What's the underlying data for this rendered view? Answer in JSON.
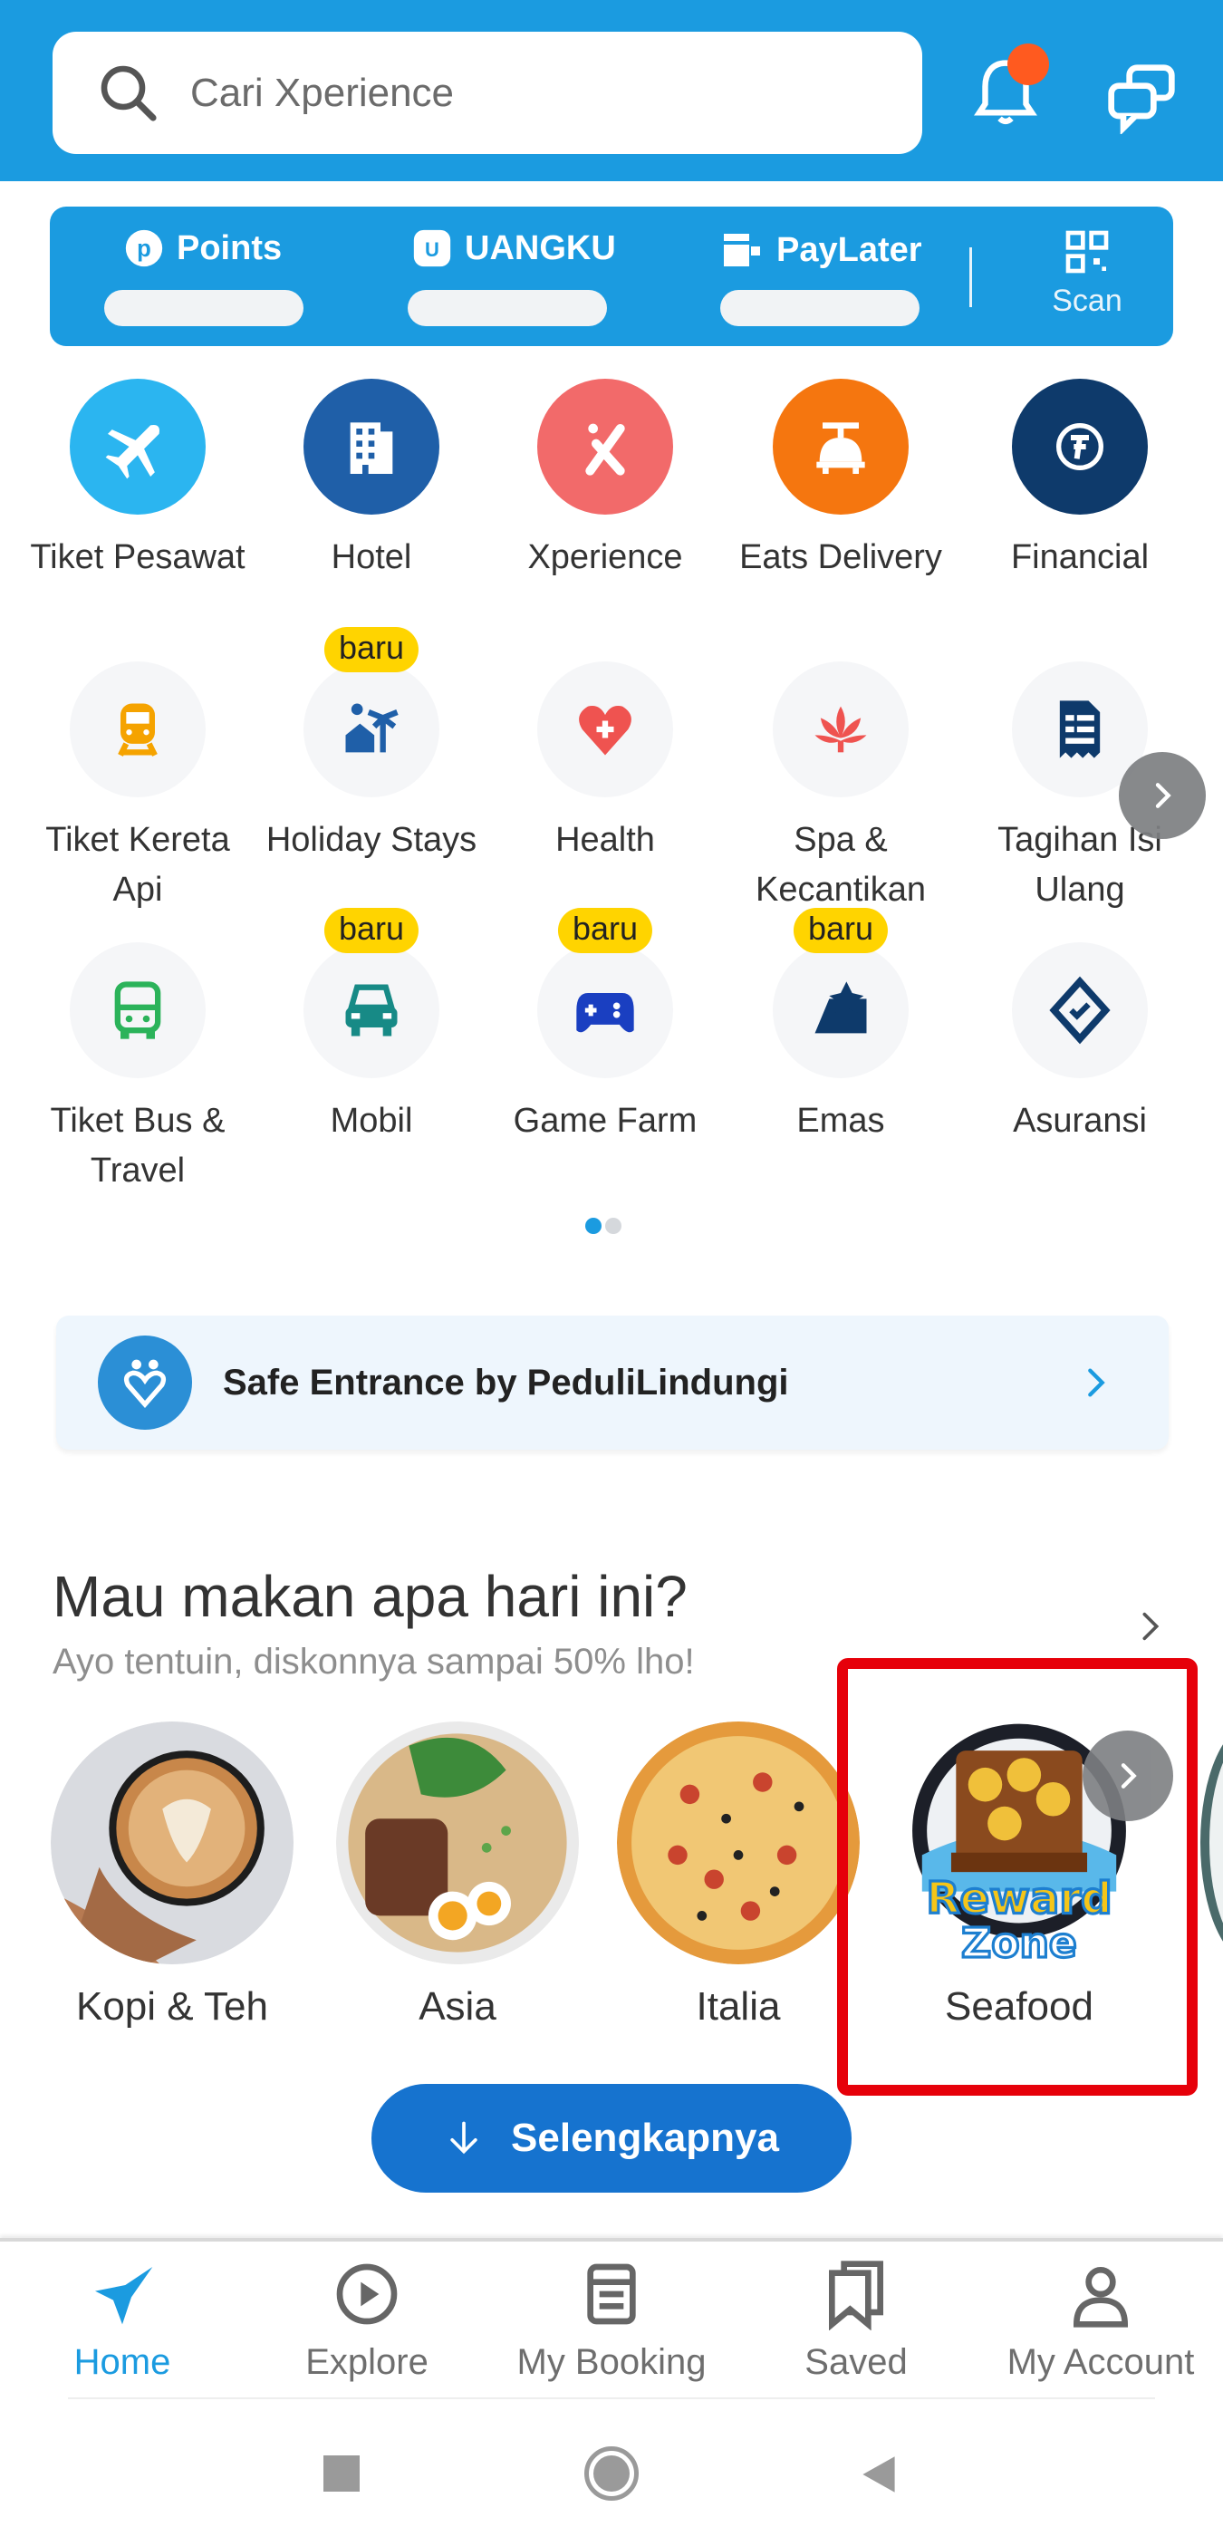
{
  "header": {
    "search_placeholder": "Cari Xperience",
    "notification_badge_color": "#ff5a1f",
    "brand_color": "#1b9be0"
  },
  "wallet": {
    "items": [
      {
        "label": "Points",
        "icon": "points-icon"
      },
      {
        "label": "UANGKU",
        "icon": "uangku-icon"
      },
      {
        "label": "PayLater",
        "icon": "paylater-icon"
      }
    ],
    "scan_label": "Scan"
  },
  "products": [
    {
      "label": "Tiket Pesawat",
      "icon": "airplane-icon",
      "bg": "#2bb5f0",
      "badge": null
    },
    {
      "label": "Hotel",
      "icon": "hotel-icon",
      "bg": "#1f5fa8",
      "badge": null
    },
    {
      "label": "Xperience",
      "icon": "xperience-icon",
      "bg": "#f26a6a",
      "badge": null
    },
    {
      "label": "Eats Delivery",
      "icon": "eats-icon",
      "bg": "#f5760f",
      "badge": null
    },
    {
      "label": "Financial",
      "icon": "financial-icon",
      "bg": "#0e3a6b",
      "badge": null
    },
    {
      "label": "Tiket Kereta Api",
      "icon": "train-icon",
      "color": "#f5a300",
      "badge": null
    },
    {
      "label": "Holiday Stays",
      "icon": "holiday-stays-icon",
      "color": "#1f5fa8",
      "badge": "baru"
    },
    {
      "label": "Health",
      "icon": "health-icon",
      "color": "#ef5350",
      "badge": null
    },
    {
      "label": "Spa & Kecantikan",
      "icon": "lotus-icon",
      "color": "#ef5350",
      "badge": null
    },
    {
      "label": "Tagihan Isi Ulang",
      "icon": "bill-icon",
      "color": "#0e3a6b",
      "badge": null
    },
    {
      "label": "Tiket Bus & Travel",
      "icon": "bus-icon",
      "color": "#2bb35a",
      "badge": null
    },
    {
      "label": "Mobil",
      "icon": "car-icon",
      "color": "#178a86",
      "badge": "baru"
    },
    {
      "label": "Game Farm",
      "icon": "gamepad-icon",
      "color": "#1a3fc1",
      "badge": "baru"
    },
    {
      "label": "Emas",
      "icon": "gold-icon",
      "color": "#0e3a6b",
      "badge": "baru"
    },
    {
      "label": "Asuransi",
      "icon": "insurance-icon",
      "color": "#0e3a6b",
      "badge": null
    }
  ],
  "pager": {
    "pages": 2,
    "active": 1
  },
  "safe_entrance": {
    "label": "Safe Entrance by PeduliLindungi"
  },
  "food": {
    "title": "Mau makan apa hari ini?",
    "subtitle": "Ayo tentuin, diskonnya sampai 50% lho!",
    "categories": [
      {
        "label": "Kopi & Teh"
      },
      {
        "label": "Asia"
      },
      {
        "label": "Italia"
      },
      {
        "label": "Seafood",
        "overlay_text_1": "Reward",
        "overlay_text_2": "Zone"
      }
    ],
    "more_label": "Selengkapnya"
  },
  "bottom_nav": [
    {
      "label": "Home",
      "active": true
    },
    {
      "label": "Explore",
      "active": false
    },
    {
      "label": "My Booking",
      "active": false
    },
    {
      "label": "Saved",
      "active": false
    },
    {
      "label": "My Account",
      "active": false
    }
  ]
}
